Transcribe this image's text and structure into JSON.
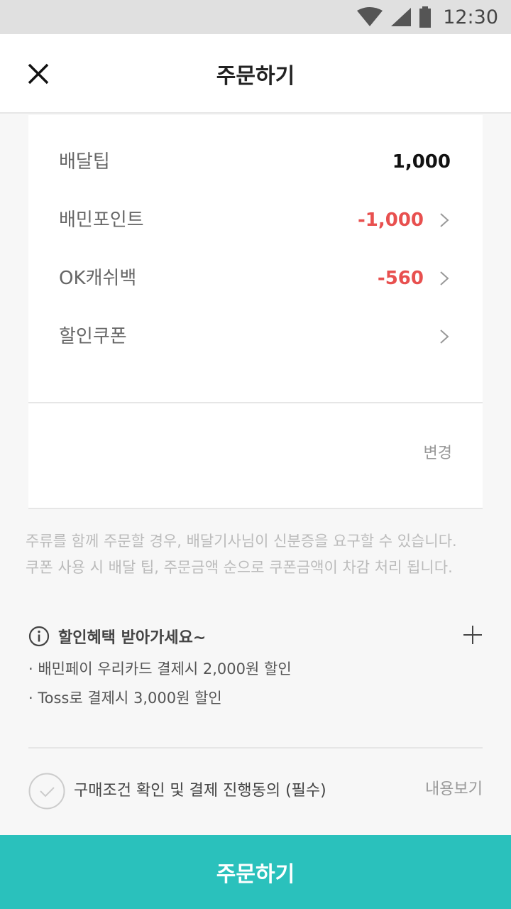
{
  "status_bar": {
    "time": "12:30",
    "icons": [
      "wifi-icon",
      "cell-signal-icon",
      "battery-icon"
    ]
  },
  "header": {
    "title": "주문하기",
    "close_icon": "close-icon"
  },
  "price_rows": [
    {
      "label": "배달팁",
      "value": "1,000"
    },
    {
      "label": "배민포인트",
      "value": "-1,000"
    },
    {
      "label": "OK캐쉬백",
      "value": "-560"
    },
    {
      "label": "할인쿠폰",
      "value": ""
    }
  ],
  "change_label": "변경",
  "notice": {
    "line1": "주류를 함께 주문할 경우, 배달기사님이 신분증을 요구할 수 있습니다.",
    "line2": "쿠폰 사용 시 배달 팁, 주문금액 순으로 쿠폰금액이 차감 처리 됩니다."
  },
  "benefits": {
    "title": "할인혜택 받아가세요~",
    "items": [
      "· 배민페이 우리카드 결제시 2,000원 할인",
      "· Toss로 결제시 3,000원 할인"
    ]
  },
  "agreement": {
    "text": "구매조건 확인 및 결제 진행동의 (필수)",
    "view_label": "내용보기",
    "checked": false
  },
  "order_button_label": "주문하기",
  "colors": {
    "accent": "#2ac1bc",
    "negative": "#e8504f",
    "background": "#f7f7f7",
    "status_bar": "#e0e0e0"
  }
}
